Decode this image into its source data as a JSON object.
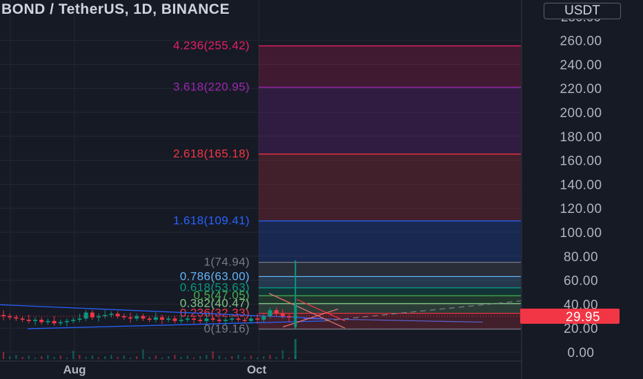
{
  "header": {
    "title": "BOND / TetherUS, 1D, BINANCE",
    "currency": "USDT"
  },
  "price_scale": {
    "ticks": [
      "0.00",
      "20.00",
      "40.00",
      "60.00",
      "80.00",
      "100.00",
      "120.00",
      "140.00",
      "160.00",
      "180.00",
      "200.00",
      "220.00",
      "240.00",
      "260.00"
    ],
    "partial_top_tick": "280.00",
    "last_price": "29.95",
    "last_price_color": "#f23645"
  },
  "time_scale": {
    "labels": [
      "Aug",
      "Oct"
    ]
  },
  "fib_levels": [
    {
      "label": "0(19.16)",
      "value": 19.16,
      "color": "#787b86"
    },
    {
      "label": "0.236(32.33)",
      "value": 32.33,
      "color": "#f23645"
    },
    {
      "label": "0.382(40.47)",
      "value": 40.47,
      "color": "#81c784"
    },
    {
      "label": "0.5(47.05)",
      "value": 47.05,
      "color": "#4caf50"
    },
    {
      "label": "0.618(53.63)",
      "value": 53.63,
      "color": "#089981"
    },
    {
      "label": "0.786(63.00)",
      "value": 63.0,
      "color": "#64b5f6"
    },
    {
      "label": "1(74.94)",
      "value": 74.94,
      "color": "#787b86"
    },
    {
      "label": "1.618(109.41)",
      "value": 109.41,
      "color": "#2962ff"
    },
    {
      "label": "2.618(165.18)",
      "value": 165.18,
      "color": "#f23645"
    },
    {
      "label": "3.618(220.95)",
      "value": 220.95,
      "color": "#9c27b0"
    },
    {
      "label": "4.236(255.42)",
      "value": 255.42,
      "color": "#e91e63"
    }
  ],
  "chart_data": {
    "type": "candlestick",
    "symbol": "BOND / TetherUS",
    "interval": "1D",
    "exchange": "BINANCE",
    "ylim": [
      0,
      280
    ],
    "price_ticks": [
      0,
      20,
      40,
      60,
      80,
      100,
      120,
      140,
      160,
      180,
      200,
      220,
      240,
      260
    ],
    "x_labels": [
      "Aug",
      "Oct"
    ],
    "last_price": 29.95,
    "series": [
      {
        "name": "price",
        "approx_closes": [
          30,
          29,
          28,
          27,
          26,
          27,
          25,
          26,
          24,
          25,
          26,
          27,
          28,
          33,
          29,
          30,
          31,
          32,
          30,
          29,
          28,
          30,
          28,
          27,
          29,
          27,
          28,
          26,
          27,
          28,
          27,
          26,
          28,
          27,
          26,
          27,
          28,
          27,
          26,
          28,
          27,
          30,
          35,
          32,
          30,
          29,
          30
        ]
      },
      {
        "name": "spike",
        "high": 76.5,
        "low": 19
      }
    ],
    "fibonacci_extension": {
      "ratios": [
        0,
        0.236,
        0.382,
        0.5,
        0.618,
        0.786,
        1,
        1.618,
        2.618,
        3.618,
        4.236
      ],
      "prices": [
        19.16,
        32.33,
        40.47,
        47.05,
        53.63,
        63.0,
        74.94,
        109.41,
        165.18,
        220.95,
        255.42
      ]
    }
  }
}
